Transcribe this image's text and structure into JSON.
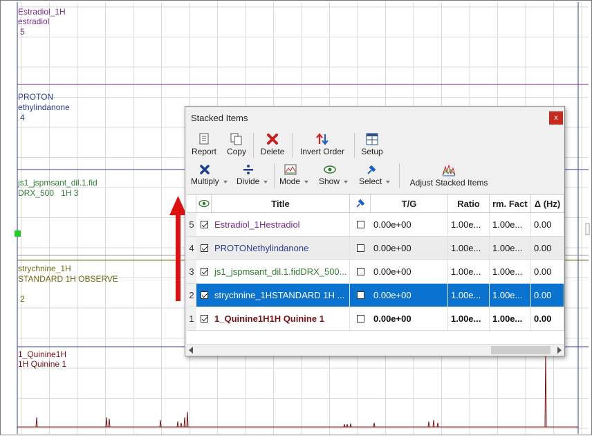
{
  "spectra": [
    {
      "name": "Estradiol_1H",
      "title": "estradiol",
      "index": "5",
      "color": "#7a2a8e"
    },
    {
      "name": "PROTON",
      "title": "ethylindanone",
      "index": "4",
      "color": "#2a3d8c"
    },
    {
      "name": "js1_jspmsant_dil.1.fid",
      "title": "DRX_500   1H 3",
      "index": "",
      "color": "#2e7d32"
    },
    {
      "name": "strychnine_1H",
      "title": "STANDARD 1H OBSERVE",
      "index": "2",
      "color": "#6b6b10"
    },
    {
      "name": "1_Quinine1H",
      "title": "1H Quinine 1",
      "index": "",
      "color": "#7a1010"
    }
  ],
  "dialog": {
    "title": "Stacked Items",
    "close": "x",
    "toolbar1": [
      {
        "label": "Report",
        "icon": "report-icon"
      },
      {
        "label": "Copy",
        "icon": "copy-icon"
      },
      {
        "label": "Delete",
        "icon": "delete-icon"
      },
      {
        "label": "Invert Order",
        "icon": "invert-order-icon"
      },
      {
        "label": "Setup",
        "icon": "setup-icon"
      }
    ],
    "toolbar2": [
      {
        "label": "Multiply",
        "icon": "multiply-icon"
      },
      {
        "label": "Divide",
        "icon": "divide-icon"
      },
      {
        "label": "Mode",
        "icon": "mode-icon"
      },
      {
        "label": "Show",
        "icon": "eye-icon"
      },
      {
        "label": "Select",
        "icon": "pin-icon"
      },
      {
        "label": "Adjust Stacked Items",
        "icon": "adjust-stacked-icon"
      }
    ],
    "columns": [
      "",
      "Title",
      "",
      "T/G",
      "Ratio",
      "rm. Fact",
      "Δ (Hz)"
    ],
    "rows": [
      {
        "num": "5",
        "checked": true,
        "title": "Estradiol_1Hestradiol",
        "tg": "0.00e+00",
        "ratio": "1.00e...",
        "factor": "1.00e...",
        "delta": "0.00",
        "color": "#7a2a8e",
        "selected": false,
        "bold": false
      },
      {
        "num": "4",
        "checked": true,
        "title": "PROTONethylindanone",
        "tg": "0.00e+00",
        "ratio": "1.00e...",
        "factor": "1.00e...",
        "delta": "0.00",
        "color": "#2a3d8c",
        "selected": false,
        "bold": false
      },
      {
        "num": "3",
        "checked": true,
        "title": "js1_jspmsant_dil.1.fidDRX_500...",
        "tg": "0.00e+00",
        "ratio": "1.00e...",
        "factor": "1.00e...",
        "delta": "0.00",
        "color": "#2e7d32",
        "selected": false,
        "bold": false
      },
      {
        "num": "2",
        "checked": true,
        "title": "strychnine_1HSTANDARD 1H ...",
        "tg": "0.00e+00",
        "ratio": "1.00e...",
        "factor": "1.00e...",
        "delta": "0.00",
        "color": "#ffffff",
        "selected": true,
        "bold": false
      },
      {
        "num": "1",
        "checked": true,
        "title": "1_Quinine1H1H Quinine 1",
        "tg": "0.00e+00",
        "ratio": "1.00e...",
        "factor": "1.00e...",
        "delta": "0.00",
        "color": "#7a1010",
        "selected": false,
        "bold": true
      }
    ]
  },
  "colors": {
    "selection": "#0a72cf",
    "arrow": "#e01010",
    "grid": "#d8d8d8"
  }
}
